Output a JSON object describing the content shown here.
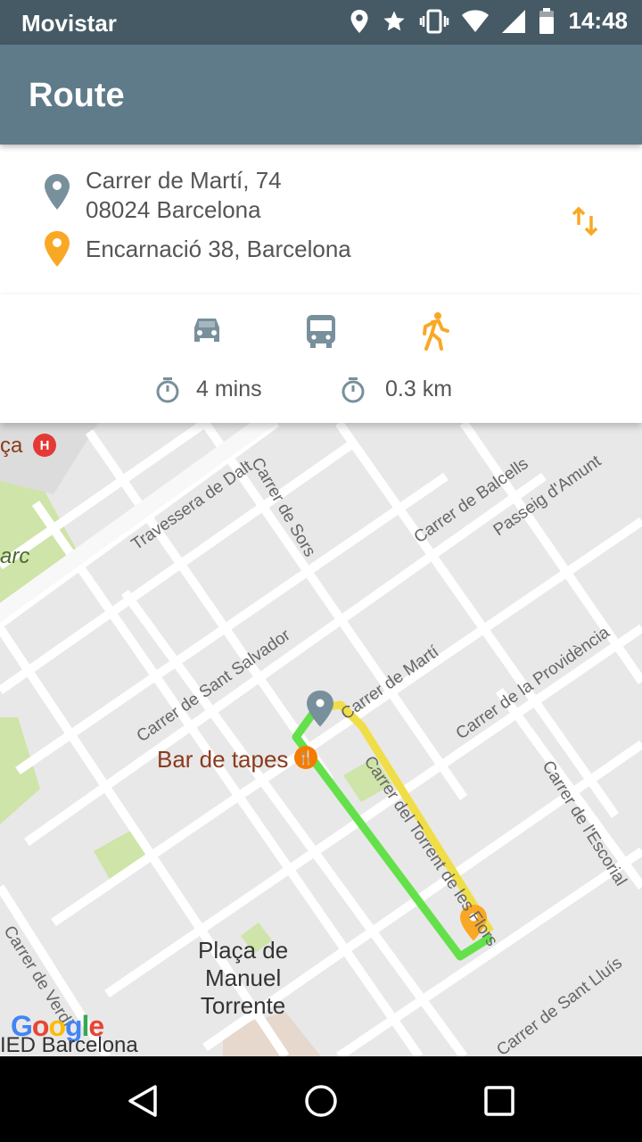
{
  "status_bar": {
    "carrier": "Movistar",
    "time": "14:48",
    "icons": [
      "location-icon",
      "star-icon",
      "vibrate-icon",
      "wifi-icon",
      "signal-icon",
      "battery-icon"
    ]
  },
  "app_bar": {
    "title": "Route"
  },
  "route": {
    "origin_line1": "Carrer de Martí, 74",
    "origin_line2": "08024 Barcelona",
    "destination": "Encarnació 38, Barcelona",
    "swap_icon": "swap-vertical-icon"
  },
  "modes": {
    "items": [
      {
        "name": "car",
        "icon": "car-icon",
        "selected": false
      },
      {
        "name": "bus",
        "icon": "bus-icon",
        "selected": false
      },
      {
        "name": "walk",
        "icon": "walk-icon",
        "selected": true
      }
    ],
    "duration": "4 mins",
    "distance": "0.3 km"
  },
  "map": {
    "street_labels": [
      "Travessera de Dalt",
      "Carrer de Sors",
      "Carrer de Balcells",
      "Passeig d'Amunt",
      "Carrer de Sant Salvador",
      "Carrer de Martí",
      "Carrer de la Providència",
      "Carrer del Torrent de les Flors",
      "Carrer de l'Escorial",
      "Carrer de Verdi",
      "Carrer de Sant Lluís"
    ],
    "poi_bar": "Bar de tapes",
    "place_label": "Plaça de\nManuel\nTorrente",
    "edge_label_top": "ça",
    "edge_label_park": "arc",
    "edge_label_bottom": "IED Barcelona",
    "hospital_symbol": "H",
    "poi_symbol": "🍴",
    "logo_text": "Google",
    "colors": {
      "route_walk": "#64e04b",
      "route_street": "#f0de48",
      "origin_pin": "#78909c",
      "destination_pin": "#f9a825",
      "park": "#cfe4a8",
      "accent": "#f9a825"
    }
  },
  "nav_bar": {
    "back": "back-icon",
    "home": "home-icon",
    "recents": "recents-icon"
  }
}
